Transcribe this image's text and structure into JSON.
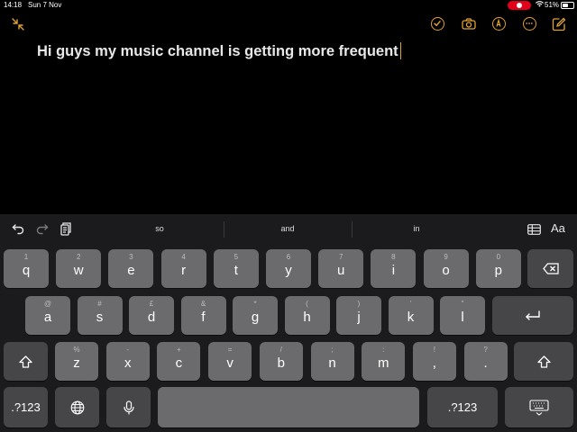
{
  "status": {
    "time": "14:18",
    "date": "Sun 7 Nov",
    "battery": "51%",
    "battery_level": 0.51
  },
  "note": {
    "text": "Hi guys my music channel is getting more frequent"
  },
  "suggestions": [
    "so",
    "and",
    "in"
  ],
  "keyboard": {
    "row1": [
      {
        "hint": "1",
        "main": "q"
      },
      {
        "hint": "2",
        "main": "w"
      },
      {
        "hint": "3",
        "main": "e"
      },
      {
        "hint": "4",
        "main": "r"
      },
      {
        "hint": "5",
        "main": "t"
      },
      {
        "hint": "6",
        "main": "y"
      },
      {
        "hint": "7",
        "main": "u"
      },
      {
        "hint": "8",
        "main": "i"
      },
      {
        "hint": "9",
        "main": "o"
      },
      {
        "hint": "0",
        "main": "p"
      }
    ],
    "row2": [
      {
        "hint": "@",
        "main": "a"
      },
      {
        "hint": "#",
        "main": "s"
      },
      {
        "hint": "£",
        "main": "d"
      },
      {
        "hint": "&",
        "main": "f"
      },
      {
        "hint": "*",
        "main": "g"
      },
      {
        "hint": "(",
        "main": "h"
      },
      {
        "hint": ")",
        "main": "j"
      },
      {
        "hint": "'",
        "main": "k"
      },
      {
        "hint": "\"",
        "main": "l"
      }
    ],
    "row3": [
      {
        "hint": "%",
        "main": "z"
      },
      {
        "hint": "-",
        "main": "x"
      },
      {
        "hint": "+",
        "main": "c"
      },
      {
        "hint": "=",
        "main": "v"
      },
      {
        "hint": "/",
        "main": "b"
      },
      {
        "hint": ";",
        "main": "n"
      },
      {
        "hint": ":",
        "main": "m"
      },
      {
        "hint": "!",
        "main": ","
      },
      {
        "hint": "?",
        "main": "."
      }
    ],
    "numbers_label": ".?123"
  },
  "colors": {
    "accent": "#e0a230",
    "record": "#e3001b",
    "key": "#6b6b6d",
    "key_dark": "#464648"
  }
}
